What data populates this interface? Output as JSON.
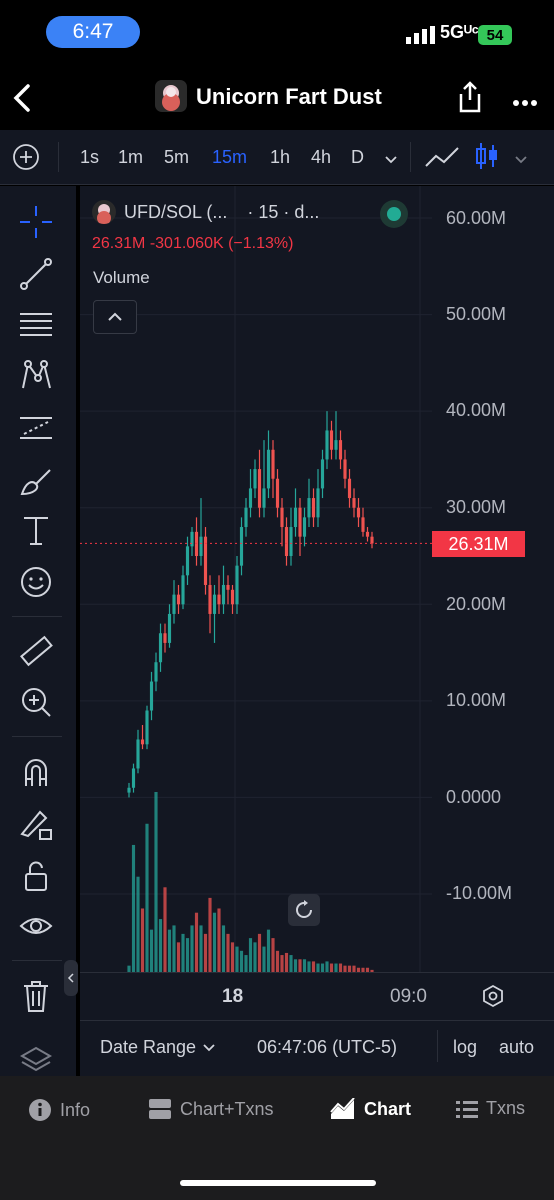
{
  "status": {
    "time": "6:47",
    "network": "5Gᵁᶜ",
    "battery": "54"
  },
  "header": {
    "title": "Unicorn Fart Dust"
  },
  "toolbar": {
    "timeframes": [
      "1s",
      "1m",
      "5m",
      "15m",
      "1h",
      "4h",
      "D"
    ],
    "active": "15m"
  },
  "legend": {
    "symbol": "UFD/SOL (...",
    "interval": "· 15 · d...",
    "values": "26.31M  -301.060K (−1.13%)",
    "volume_label": "Volume"
  },
  "price_axis": [
    "60.00M",
    "50.00M",
    "40.00M",
    "30.00M",
    "20.00M",
    "10.00M",
    "0.0000",
    "-10.00M"
  ],
  "last_price": "26.31M",
  "time_axis": {
    "label_1": "18",
    "label_2": "09:0"
  },
  "bottom": {
    "date_range": "Date Range",
    "clock": "06:47:06 (UTC-5)",
    "log": "log",
    "auto": "auto"
  },
  "tabs": {
    "info": "Info",
    "chart_txns": "Chart+Txns",
    "chart": "Chart",
    "txns": "Txns"
  },
  "colors": {
    "up": "#26a69a",
    "down": "#ef5350",
    "accent": "#2962ff"
  },
  "chart_data": {
    "type": "candlestick",
    "title": "UFD/SOL (...",
    "ylim": [
      -10000000,
      60000000
    ],
    "last": 26310000,
    "candles": [
      [
        0.5,
        1,
        0,
        1.5,
        1
      ],
      [
        1,
        3,
        0.5,
        3.5,
        1
      ],
      [
        3,
        6,
        2.5,
        7,
        1
      ],
      [
        6,
        5.5,
        5,
        7.5,
        0
      ],
      [
        5.5,
        9,
        5,
        9.5,
        1
      ],
      [
        9,
        12,
        8,
        13,
        1
      ],
      [
        12,
        14,
        11,
        15,
        1
      ],
      [
        14,
        17,
        13,
        18,
        1
      ],
      [
        17,
        16,
        15,
        18,
        0
      ],
      [
        16,
        19,
        15.5,
        20,
        1
      ],
      [
        19,
        21,
        18,
        22.5,
        1
      ],
      [
        21,
        20,
        19,
        22,
        0
      ],
      [
        20,
        23,
        19.5,
        24,
        1
      ],
      [
        23,
        26,
        22,
        27,
        1
      ],
      [
        26,
        27.5,
        25,
        28,
        1
      ],
      [
        27.5,
        25,
        24,
        29,
        0
      ],
      [
        25,
        27,
        24,
        31,
        1
      ],
      [
        27,
        22,
        21,
        28,
        0
      ],
      [
        22,
        19,
        17,
        23,
        0
      ],
      [
        19,
        21,
        16,
        22,
        1
      ],
      [
        21,
        20,
        19,
        23,
        0
      ],
      [
        20,
        22,
        19,
        24,
        1
      ],
      [
        22,
        21.5,
        20,
        23,
        0
      ],
      [
        21.5,
        20,
        19,
        22,
        0
      ],
      [
        20,
        24,
        19,
        25,
        1
      ],
      [
        24,
        28,
        23,
        29,
        1
      ],
      [
        28,
        30,
        27,
        31,
        1
      ],
      [
        30,
        32,
        29,
        34,
        1
      ],
      [
        32,
        34,
        31,
        35,
        1
      ],
      [
        34,
        30,
        29,
        36,
        0
      ],
      [
        30,
        32,
        29,
        37,
        1
      ],
      [
        32,
        36,
        31,
        38,
        1
      ],
      [
        36,
        33,
        31,
        37,
        0
      ],
      [
        33,
        30,
        29,
        34,
        0
      ],
      [
        30,
        28,
        26,
        31,
        0
      ],
      [
        28,
        25,
        24,
        29,
        0
      ],
      [
        25,
        28,
        24,
        30,
        1
      ],
      [
        28,
        30,
        27,
        32,
        1
      ],
      [
        30,
        27,
        25,
        31,
        0
      ],
      [
        27,
        29,
        26,
        30,
        1
      ],
      [
        29,
        31,
        28,
        33,
        1
      ],
      [
        31,
        29,
        28,
        32,
        0
      ],
      [
        29,
        32,
        28,
        34,
        1
      ],
      [
        32,
        35,
        31,
        36,
        1
      ],
      [
        35,
        38,
        34,
        40,
        1
      ],
      [
        38,
        36,
        35,
        39,
        0
      ],
      [
        36,
        37,
        35,
        40,
        1
      ],
      [
        37,
        35,
        34,
        38,
        0
      ],
      [
        35,
        33,
        32,
        36,
        0
      ],
      [
        33,
        31,
        30,
        34,
        0
      ],
      [
        31,
        30,
        29,
        32,
        0
      ],
      [
        30,
        29,
        28,
        31,
        0
      ],
      [
        29,
        27.5,
        27,
        30,
        0
      ],
      [
        27.5,
        27,
        26.5,
        28,
        0
      ],
      [
        27,
        26.3,
        25.8,
        27.5,
        0
      ]
    ],
    "volumes": [
      3,
      60,
      45,
      30,
      70,
      20,
      85,
      25,
      40,
      20,
      22,
      14,
      18,
      16,
      22,
      28,
      22,
      18,
      35,
      28,
      30,
      22,
      18,
      14,
      12,
      10,
      8,
      16,
      14,
      18,
      12,
      20,
      16,
      10,
      8,
      9,
      8,
      6,
      6,
      6,
      5,
      5,
      4,
      4,
      5,
      4,
      4,
      4,
      3,
      3,
      3,
      2,
      2,
      2,
      1
    ]
  }
}
